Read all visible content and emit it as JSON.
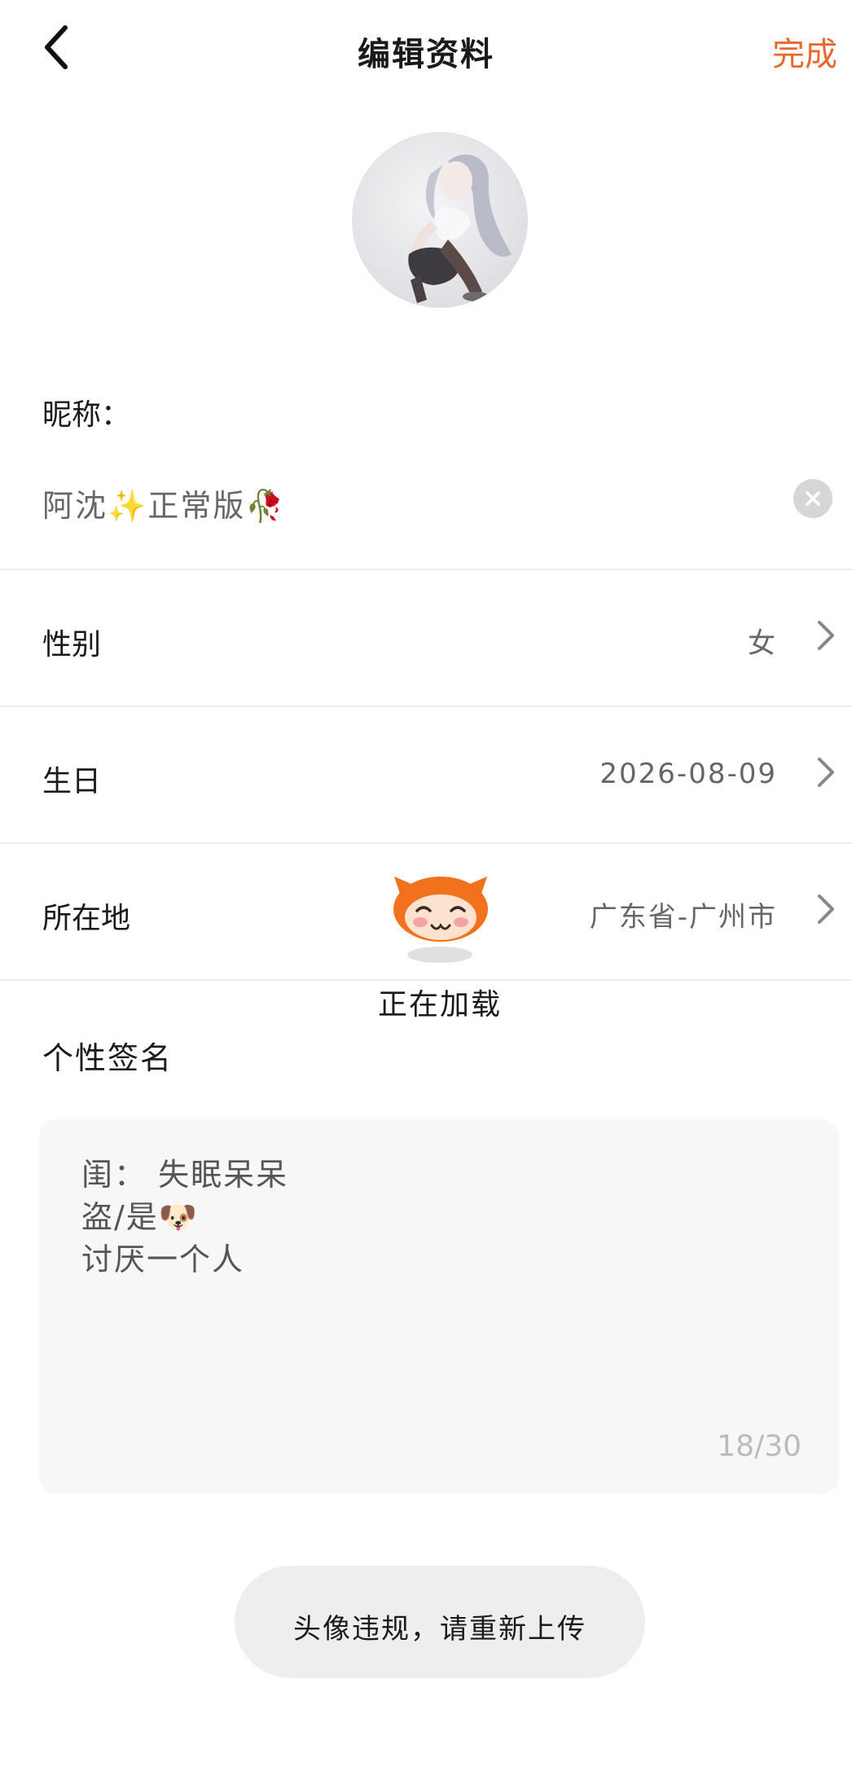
{
  "header": {
    "title": "编辑资料",
    "done_label": "完成"
  },
  "nickname": {
    "label": "昵称：",
    "value_part1": "阿沈",
    "sparkle": "✨",
    "value_part2": "正常版",
    "rose": "🥀"
  },
  "rows": [
    {
      "label": "性别",
      "value": "女"
    },
    {
      "label": "生日",
      "value": "2026-08-09"
    },
    {
      "label": "所在地",
      "value": "广东省-广州市"
    }
  ],
  "loading": {
    "text": "正在加载"
  },
  "signature": {
    "label": "个性签名",
    "text": "闺： 失眠呆呆\n盗/是🐶\n讨厌一个人",
    "counter": "18/30"
  },
  "toast": {
    "text": "头像违规，请重新上传"
  },
  "colors": {
    "accent": "#e8692c",
    "mascot": "#f2711c"
  }
}
